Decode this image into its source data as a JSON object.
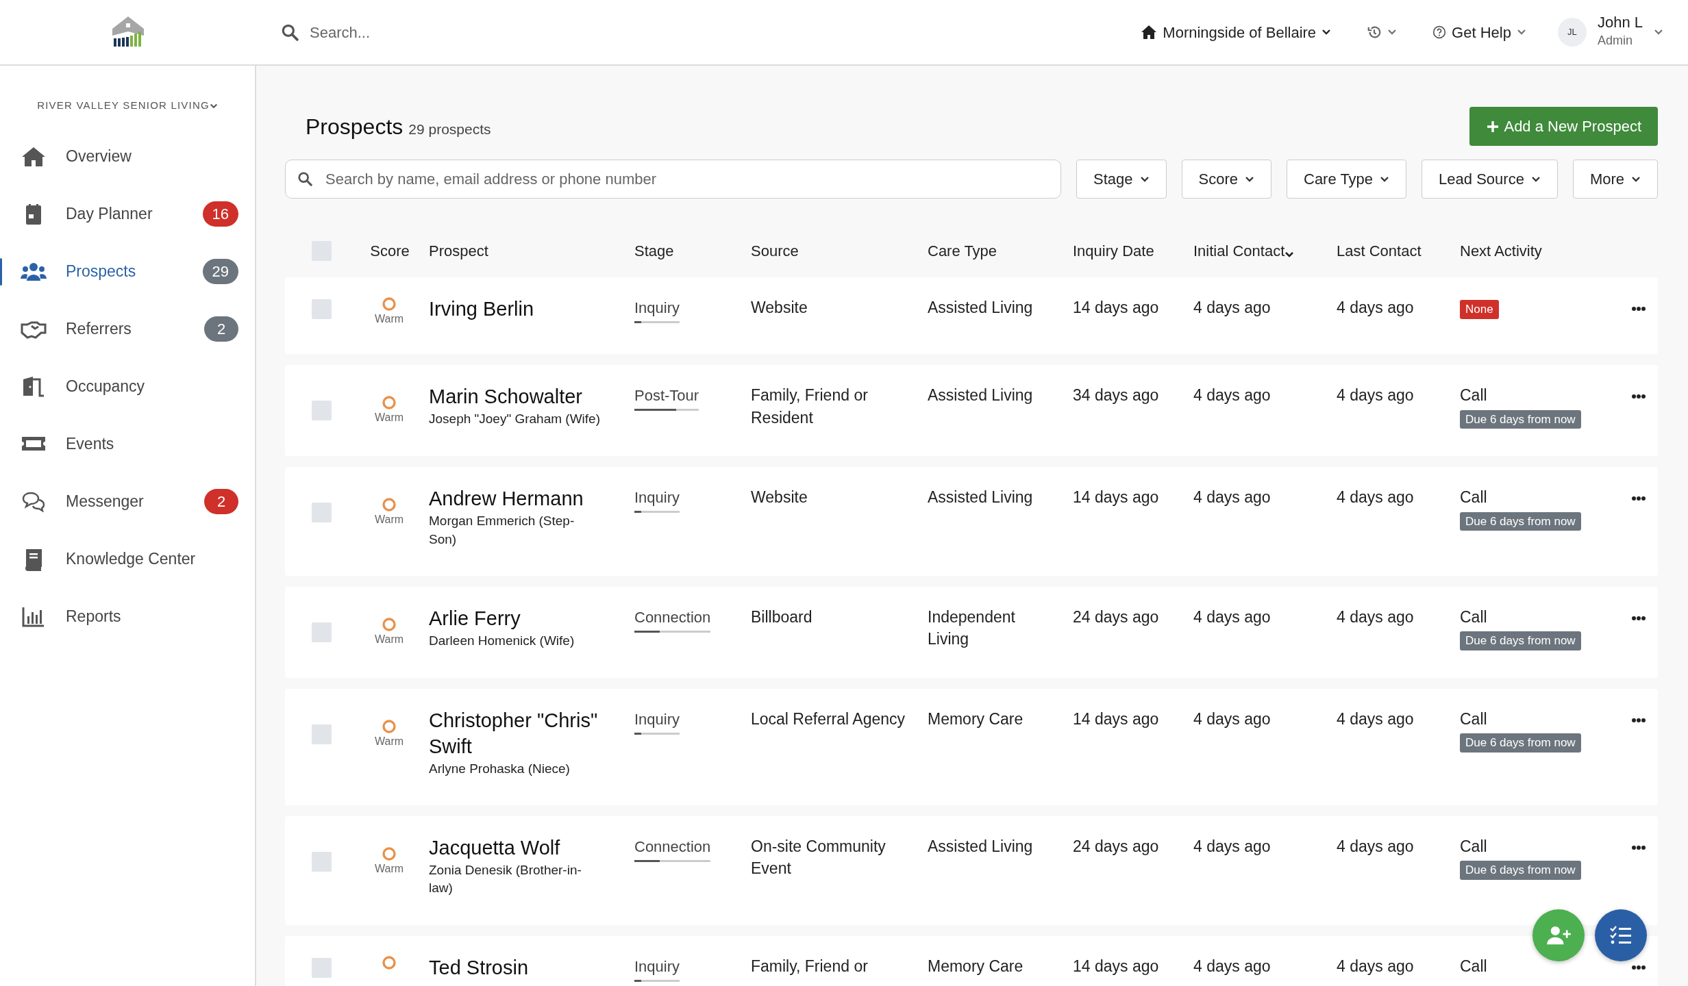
{
  "header": {
    "search_placeholder": "Search...",
    "community": "Morningside of Bellaire",
    "help": "Get Help",
    "user": {
      "initials": "JL",
      "name": "John L",
      "role": "Admin"
    }
  },
  "sidebar": {
    "org": "RIVER VALLEY SENIOR LIVING",
    "items": [
      {
        "label": "Overview",
        "selected": false
      },
      {
        "label": "Day Planner",
        "badge": "16",
        "color": "#d0302a",
        "selected": false
      },
      {
        "label": "Prospects",
        "badge": "29",
        "color": "#6c757d",
        "selected": true
      },
      {
        "label": "Referrers",
        "badge": "2",
        "color": "#6c757d",
        "selected": false
      },
      {
        "label": "Occupancy",
        "selected": false
      },
      {
        "label": "Events",
        "selected": false
      },
      {
        "label": "Messenger",
        "badge": "2",
        "color": "#d0302a",
        "selected": false
      },
      {
        "label": "Knowledge Center",
        "selected": false
      },
      {
        "label": "Reports",
        "selected": false
      }
    ]
  },
  "page": {
    "title": "Prospects",
    "count": "29 prospects",
    "add_button": "Add a New Prospect",
    "search_placeholder": "Search by name, email address or phone number",
    "filters": [
      "Stage",
      "Score",
      "Care Type",
      "Lead Source",
      "More"
    ],
    "select_all": {
      "checked": false
    },
    "columns": [
      {
        "label": "Score",
        "sorted": false
      },
      {
        "label": "Prospect",
        "sorted": false
      },
      {
        "label": "Stage",
        "sorted": false
      },
      {
        "label": "Source",
        "sorted": false
      },
      {
        "label": "Care Type",
        "sorted": false
      },
      {
        "label": "Inquiry Date",
        "sorted": false
      },
      {
        "label": "Initial Contact",
        "sorted": true
      },
      {
        "label": "Last Contact",
        "sorted": false
      },
      {
        "label": "Next Activity",
        "sorted": false
      }
    ],
    "rows": [
      {
        "checked": false,
        "score": "Warm",
        "name": "Irving Berlin",
        "stage": "Inquiry",
        "level": 0.15,
        "source": "Website",
        "care_type": "Assisted Living",
        "inquiry_date": "14 days ago",
        "initial_contact": "4 days ago",
        "last_contact": "4 days ago",
        "next": {
          "kind": "none",
          "label": "None"
        }
      },
      {
        "checked": false,
        "score": "Warm",
        "name": "Marin Schowalter",
        "contact": "Joseph \"Joey\" Graham (Wife)",
        "stage": "Post-Tour",
        "level": 0.65,
        "source": "Family, Friend or Resident",
        "care_type": "Assisted Living",
        "inquiry_date": "34 days ago",
        "initial_contact": "4 days ago",
        "last_contact": "4 days ago",
        "next": {
          "kind": "task",
          "label": "Call",
          "due": "Due 6 days from now"
        }
      },
      {
        "checked": false,
        "score": "Warm",
        "name": "Andrew Hermann",
        "contact": "Morgan Emmerich (Step-Son)",
        "stage": "Inquiry",
        "level": 0.15,
        "source": "Website",
        "care_type": "Assisted Living",
        "inquiry_date": "14 days ago",
        "initial_contact": "4 days ago",
        "last_contact": "4 days ago",
        "next": {
          "kind": "task",
          "label": "Call",
          "due": "Due 6 days from now"
        }
      },
      {
        "checked": false,
        "score": "Warm",
        "name": "Arlie Ferry",
        "contact": "Darleen Homenick (Wife)",
        "stage": "Connection",
        "level": 0.33,
        "source": "Billboard",
        "care_type": "Independent Living",
        "inquiry_date": "24 days ago",
        "initial_contact": "4 days ago",
        "last_contact": "4 days ago",
        "next": {
          "kind": "task",
          "label": "Call",
          "due": "Due 6 days from now"
        }
      },
      {
        "checked": false,
        "score": "Warm",
        "name": "Christopher \"Chris\" Swift",
        "contact": "Arlyne Prohaska (Niece)",
        "stage": "Inquiry",
        "level": 0.15,
        "source": "Local Referral Agency",
        "care_type": "Memory Care",
        "inquiry_date": "14 days ago",
        "initial_contact": "4 days ago",
        "last_contact": "4 days ago",
        "next": {
          "kind": "task",
          "label": "Call",
          "due": "Due 6 days from now"
        }
      },
      {
        "checked": false,
        "score": "Warm",
        "name": "Jacquetta Wolf",
        "contact": "Zonia Denesik (Brother-in-law)",
        "stage": "Connection",
        "level": 0.33,
        "source": "On-site Community Event",
        "care_type": "Assisted Living",
        "inquiry_date": "24 days ago",
        "initial_contact": "4 days ago",
        "last_contact": "4 days ago",
        "next": {
          "kind": "task",
          "label": "Call",
          "due": "Due 6 days from now"
        }
      },
      {
        "checked": false,
        "name": "Ted Strosin",
        "stage": "Inquiry",
        "level": 0.15,
        "source": "Family, Friend or",
        "care_type": "Memory Care",
        "inquiry_date": "14 days ago",
        "initial_contact": "4 days ago",
        "last_contact": "4 days ago",
        "next": {
          "kind": "task",
          "label": "Call"
        }
      }
    ]
  }
}
